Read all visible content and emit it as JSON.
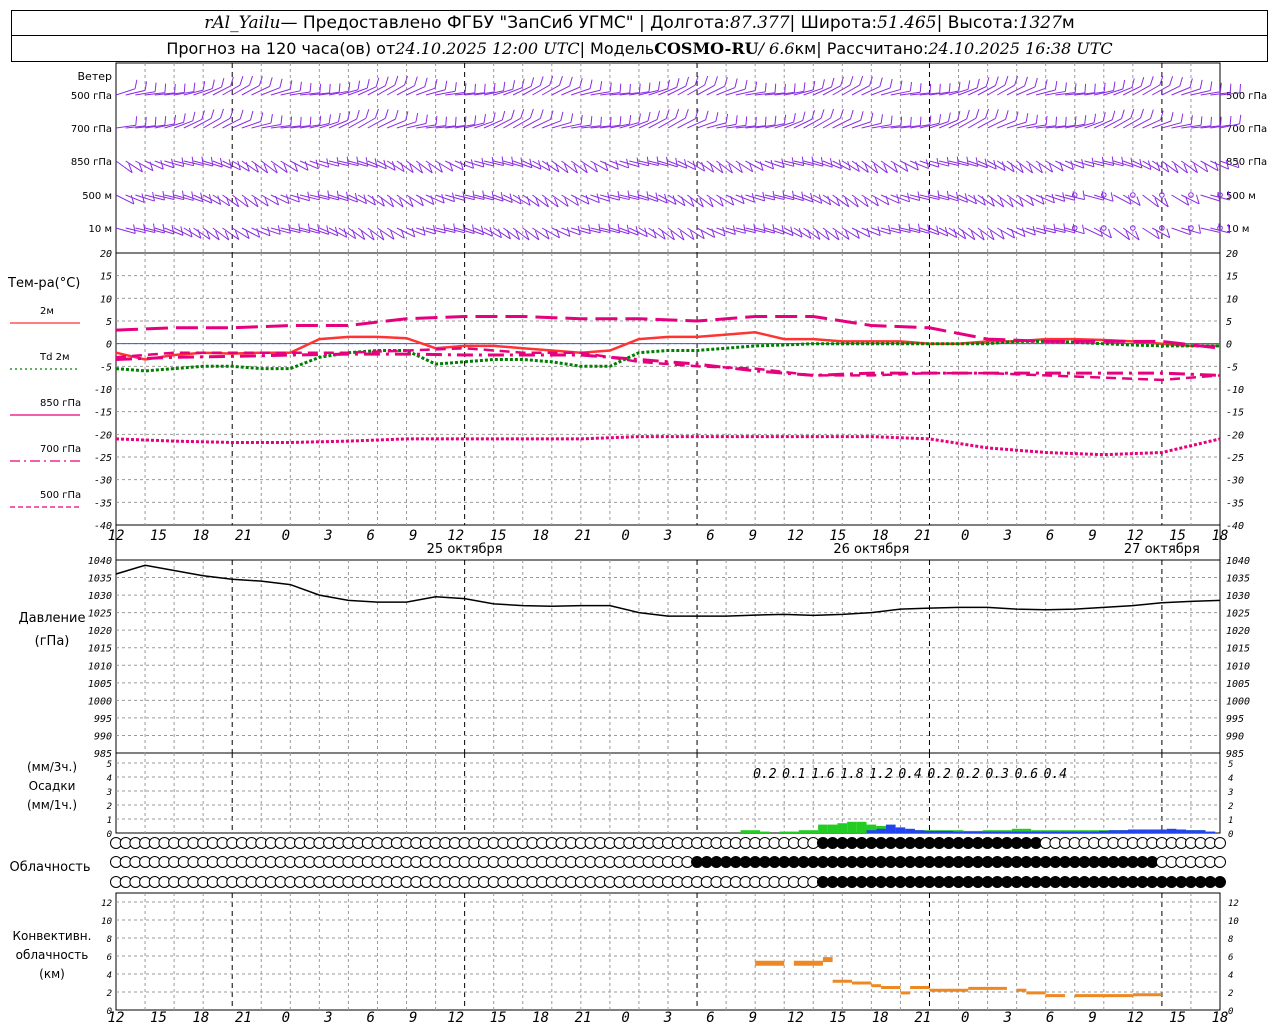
{
  "header": {
    "station": "rAl_Yailu",
    "provider": " — Предоставлено ФГБУ \"ЗапСиб УГМС\" | Долгота: ",
    "lon": "87.377",
    "lat_label": " | Широта: ",
    "lat": "51.465",
    "alt_label": " | Высота: ",
    "alt": "1327",
    "alt_unit": "м",
    "forecast_label": "Прогноз на 120 часа(ов) от ",
    "forecast_start": "24.10.2025 12:00 UTC",
    "model_label": "  | Модель ",
    "model": "COSMO-RU",
    "res": " / 6.6",
    "res_unit": "км",
    "calc_label": " | Рассчитано: ",
    "calc_time": "24.10.2025 16:38 UTC"
  },
  "colors": {
    "wind": "#8a2be2",
    "t2m": "#ff3333",
    "td2m": "#007f00",
    "t850": "#e6007e",
    "t700": "#e6007e",
    "t500": "#e6007e",
    "pressure": "#000000",
    "precip_rain": "#22cc22",
    "precip_snow": "#2244ee",
    "convective": "#ee8822",
    "grid": "#9a9a9a"
  },
  "chart_data": {
    "type": "line",
    "x_ticks": [
      "12",
      "15",
      "18",
      "21",
      "0",
      "3",
      "6",
      "9",
      "12",
      "15",
      "18",
      "21",
      "0",
      "3",
      "6",
      "9",
      "12",
      "15",
      "18",
      "21",
      "0",
      "3",
      "6",
      "9",
      "12",
      "15",
      "18"
    ],
    "day_labels": [
      "25 октября",
      "26 октября",
      "27 октября"
    ],
    "wind": {
      "label": "Ветер",
      "levels": [
        "500 гПа",
        "700 гПа",
        "850 гПа",
        "500 м",
        "10  м"
      ]
    },
    "temperature": {
      "label": "Тем-ра(°С)",
      "ylim": [
        -40,
        20
      ],
      "y_ticks": [
        20,
        15,
        10,
        5,
        0,
        -5,
        -10,
        -15,
        -20,
        -25,
        -30,
        -35,
        -40
      ],
      "legend": [
        {
          "key": "t2m",
          "label": "2м",
          "style": "solid"
        },
        {
          "key": "td2m",
          "label": "Td  2м",
          "style": "dotted"
        },
        {
          "key": "t850",
          "label": "850 гПа",
          "style": "solid"
        },
        {
          "key": "t700",
          "label": "700 гПа",
          "style": "dashdot"
        },
        {
          "key": "t500",
          "label": "500 гПа",
          "style": "dashed"
        }
      ],
      "series": [
        {
          "name": "2м",
          "key": "t2m",
          "x": [
            0,
            3,
            6,
            9,
            12,
            15,
            18,
            21,
            24,
            27,
            30,
            33,
            36,
            39,
            42,
            45,
            48,
            51,
            54,
            57,
            60,
            63,
            66,
            69,
            72,
            75,
            78,
            81,
            84,
            87,
            90,
            93,
            96,
            99,
            102,
            105,
            108,
            111,
            114
          ],
          "y": [
            -2,
            -3.5,
            -2.5,
            -2,
            -2.2,
            -2,
            -2,
            1,
            1.5,
            1.5,
            1.2,
            -1,
            -0.5,
            -0.5,
            -1,
            -1.5,
            -2,
            -1.5,
            1,
            1.5,
            1.5,
            2,
            2.5,
            1,
            1,
            0.5,
            0.5,
            0.5,
            0,
            0,
            0.5,
            0.5,
            1,
            1,
            0.8,
            0.5,
            0,
            -0.5,
            -0.5
          ]
        },
        {
          "name": "Td  2м",
          "key": "td2m",
          "x": [
            0,
            3,
            6,
            9,
            12,
            15,
            18,
            21,
            24,
            27,
            30,
            33,
            36,
            39,
            42,
            45,
            48,
            51,
            54,
            57,
            60,
            63,
            66,
            69,
            72,
            75,
            78,
            81,
            84,
            87,
            90,
            93,
            96,
            99,
            102,
            105,
            108,
            111,
            114
          ],
          "y": [
            -5.5,
            -6,
            -5.5,
            -5,
            -5,
            -5.5,
            -5.5,
            -3,
            -2,
            -1.5,
            -1.5,
            -4.5,
            -4,
            -3.5,
            -3.5,
            -4,
            -5,
            -5,
            -2,
            -1.5,
            -1.5,
            -1,
            -0.5,
            -0.3,
            0,
            0,
            0,
            0,
            0,
            0,
            0,
            0.5,
            0.5,
            0.3,
            0,
            -0.3,
            -0.5,
            -0.5,
            -0.5
          ]
        },
        {
          "name": "850 гПа",
          "key": "t850",
          "x": [
            0,
            6,
            12,
            18,
            24,
            30,
            36,
            42,
            48,
            54,
            60,
            66,
            72,
            78,
            84,
            90,
            96,
            102,
            108,
            114
          ],
          "y": [
            -3.5,
            -3,
            -2.8,
            -2.5,
            -2.3,
            -2.3,
            -2.5,
            -2.5,
            -2.5,
            -3.5,
            -4.5,
            -6,
            -7,
            -6.5,
            -6.5,
            -6.5,
            -6.5,
            -6.5,
            -6.5,
            -7
          ]
        },
        {
          "name": "700 гПа",
          "key": "t700",
          "x": [
            0,
            6,
            12,
            18,
            24,
            30,
            36,
            42,
            48,
            54,
            60,
            66,
            72,
            78,
            84,
            90,
            96,
            102,
            108,
            114
          ],
          "y": [
            -3,
            -2,
            -2,
            -2,
            -2,
            -1.5,
            -1,
            -2,
            -2,
            -4,
            -5,
            -5.5,
            -7,
            -7,
            -6.5,
            -6.5,
            -7,
            -7.5,
            -8,
            -7
          ]
        },
        {
          "name": "500 гПа",
          "key": "t500",
          "x": [
            0,
            6,
            12,
            18,
            24,
            30,
            36,
            42,
            48,
            54,
            60,
            66,
            72,
            78,
            84,
            90,
            96,
            102,
            108,
            114
          ],
          "y": [
            -21,
            -21.5,
            -21.8,
            -21.8,
            -21.5,
            -21,
            -21,
            -21,
            -21,
            -20.5,
            -20.5,
            -20.5,
            -20.5,
            -20.5,
            -21,
            -23,
            -24,
            -24.5,
            -24,
            -21
          ]
        },
        {
          "name": "",
          "key": "t850_upper",
          "x": [
            0,
            6,
            12,
            18,
            24,
            30,
            36,
            42,
            48,
            54,
            60,
            66,
            72,
            78,
            84,
            90,
            96,
            102,
            108,
            114
          ],
          "y": [
            3,
            3.5,
            3.5,
            4,
            4,
            5.5,
            6,
            6,
            5.5,
            5.5,
            5,
            6,
            6,
            4,
            3.5,
            1,
            0.5,
            0.5,
            0.5,
            -1
          ]
        }
      ]
    },
    "pressure": {
      "label1": "Давление",
      "label2": "(гПа)",
      "ylim": [
        985,
        1040
      ],
      "y_ticks": [
        1040,
        1035,
        1030,
        1025,
        1020,
        1015,
        1010,
        1005,
        1000,
        995,
        990,
        985
      ],
      "x": [
        0,
        3,
        6,
        9,
        12,
        15,
        18,
        21,
        24,
        27,
        30,
        33,
        36,
        39,
        42,
        45,
        48,
        51,
        54,
        57,
        60,
        63,
        66,
        69,
        72,
        75,
        78,
        81,
        84,
        87,
        90,
        93,
        96,
        99,
        102,
        105,
        108,
        111,
        114
      ],
      "y": [
        1036,
        1038.5,
        1037,
        1035.5,
        1034.5,
        1034,
        1033,
        1030,
        1028.5,
        1028,
        1028,
        1029.5,
        1029,
        1027.5,
        1027,
        1026.8,
        1027,
        1027,
        1025,
        1024,
        1024,
        1024,
        1024.3,
        1024.5,
        1024.2,
        1024.5,
        1025,
        1026,
        1026.3,
        1026.5,
        1026.5,
        1026,
        1025.8,
        1026,
        1026.5,
        1027,
        1027.8,
        1028.2,
        1028.5
      ]
    },
    "precip": {
      "label_mm3": "(мм/3ч.)",
      "label": "Осадки",
      "label_mm1": "(мм/1ч.)",
      "ylim": [
        0,
        5
      ],
      "y_ticks": [
        5,
        4,
        3,
        2,
        1,
        0
      ],
      "sums": [
        "0.2",
        "0.1",
        "1.6",
        "1.8",
        "1.2",
        "0.4",
        "0.2",
        "0.2",
        "0.3",
        "0.6",
        "0.4"
      ],
      "sum_x": [
        67,
        70,
        73,
        76,
        79,
        82,
        85,
        88,
        91,
        94,
        97
      ],
      "rain": {
        "x": [
          65,
          66,
          67,
          68,
          69,
          70,
          71,
          72,
          73,
          74,
          75,
          76,
          77,
          78,
          79,
          80,
          81,
          82,
          83,
          84,
          85,
          86,
          87,
          88,
          89,
          90,
          91,
          92,
          93,
          94,
          95,
          96,
          97,
          98,
          99,
          100,
          101,
          102,
          103,
          104,
          105,
          106,
          107,
          108,
          109,
          110,
          111,
          112,
          113
        ],
        "y": [
          0.2,
          0.2,
          0.1,
          0,
          0.1,
          0.1,
          0.2,
          0.2,
          0.6,
          0.6,
          0.7,
          0.8,
          0.8,
          0.6,
          0.5,
          0.3,
          0.1,
          0.2,
          0.2,
          0.2,
          0.2,
          0.2,
          0.2,
          0.15,
          0.15,
          0.2,
          0.2,
          0.2,
          0.3,
          0.3,
          0.2,
          0.2,
          0.2,
          0.2,
          0.2,
          0.2,
          0.2,
          0.2,
          0.2,
          0.2,
          0.2,
          0.2,
          0.2,
          0.2,
          0.2,
          0.2,
          0.2,
          0.2,
          0.1
        ]
      },
      "snow": {
        "x": [
          78,
          79,
          80,
          81,
          82,
          83,
          84,
          85,
          86,
          87,
          88,
          89,
          90,
          91,
          92,
          93,
          94,
          95,
          96,
          97,
          98,
          99,
          100,
          101,
          102,
          103,
          104,
          105,
          106,
          107,
          108,
          109,
          110,
          111,
          112,
          113
        ],
        "y": [
          0.2,
          0.3,
          0.6,
          0.4,
          0.3,
          0.2,
          0.15,
          0.15,
          0.15,
          0.1,
          0.1,
          0.1,
          0.1,
          0.1,
          0.1,
          0.1,
          0.1,
          0.1,
          0.1,
          0.1,
          0.1,
          0.1,
          0.1,
          0.1,
          0.15,
          0.2,
          0.2,
          0.25,
          0.25,
          0.25,
          0.25,
          0.3,
          0.25,
          0.2,
          0.2,
          0.1
        ]
      }
    },
    "cloud": {
      "label": "Облачность",
      "rows": [
        [
          0,
          0,
          1,
          0,
          0,
          0,
          0,
          0,
          0,
          0,
          0,
          0,
          0,
          0,
          0,
          0,
          0,
          0,
          0,
          0,
          0,
          0,
          0,
          0,
          0,
          0,
          0,
          0,
          0,
          0,
          0,
          0,
          0,
          0,
          0,
          0,
          0,
          0,
          0,
          0,
          0,
          0,
          0,
          0,
          0,
          0,
          0,
          0,
          0,
          0,
          0,
          0,
          0,
          0,
          0,
          0,
          0,
          0,
          0,
          0,
          0,
          0,
          0,
          0,
          0,
          0,
          0,
          0,
          0,
          0,
          0,
          0,
          0,
          0,
          0,
          0,
          0,
          0,
          0,
          0,
          0,
          0,
          0,
          0,
          0,
          0,
          0,
          0,
          0,
          0,
          0,
          0,
          0,
          0,
          0,
          0,
          0,
          0,
          0,
          0,
          0,
          0,
          0,
          0,
          0,
          0,
          0,
          0,
          0,
          0,
          0,
          0,
          0,
          0,
          0
        ],
        [
          0,
          0,
          0,
          0,
          0,
          0,
          0,
          0,
          0,
          0,
          0,
          0,
          0,
          0,
          0,
          0,
          0,
          0,
          0,
          0,
          0,
          0,
          0,
          0,
          0,
          0,
          0,
          0,
          0,
          0,
          0,
          0,
          0,
          0,
          0,
          0,
          0,
          0,
          0,
          0,
          0,
          0,
          0,
          0,
          0,
          0,
          0,
          0,
          0,
          0,
          0,
          0,
          0,
          0,
          0,
          0,
          0,
          0,
          0,
          0,
          0,
          0,
          0,
          0,
          0,
          0,
          0,
          0,
          0,
          0,
          0,
          0,
          0,
          0,
          0,
          0,
          0,
          0,
          0,
          0,
          0,
          0,
          0,
          0,
          0,
          0,
          0,
          0,
          0,
          0,
          0,
          0,
          0,
          0,
          0,
          0,
          0,
          0,
          0,
          0,
          0,
          0,
          0,
          0,
          0,
          0,
          0,
          0,
          0,
          0,
          0,
          0,
          0,
          0,
          0
        ],
        [
          0,
          0,
          0,
          0,
          0,
          0,
          0,
          0,
          0,
          0,
          0,
          0,
          0,
          0,
          0,
          0,
          0,
          0,
          0,
          0,
          0,
          0,
          0,
          0,
          0,
          0,
          0,
          0,
          0,
          0,
          0,
          0,
          0,
          0,
          0,
          0,
          0,
          0,
          0,
          0,
          0,
          0,
          0,
          0,
          0,
          0,
          0,
          0,
          0,
          0,
          0,
          0,
          0,
          0,
          0,
          0,
          0,
          0,
          0,
          0,
          0,
          0,
          0,
          0,
          0,
          0,
          0,
          0,
          0,
          0,
          0,
          0,
          0,
          0,
          0,
          0,
          0,
          0,
          0,
          0,
          0,
          0,
          0,
          0,
          0,
          0,
          0,
          0,
          0,
          0,
          0,
          0,
          0,
          0,
          0,
          0,
          0,
          0,
          0,
          0,
          0,
          0,
          0,
          0,
          0,
          0,
          0,
          0,
          0,
          0,
          0,
          0,
          0,
          0,
          0
        ]
      ],
      "note": ""
    },
    "convective": {
      "label1": "Конвективн.",
      "label2": "облачность",
      "label3": "(км)",
      "ylim": [
        0,
        13
      ],
      "y_ticks": [
        12,
        10,
        8,
        6,
        4,
        2,
        0
      ],
      "segments": [
        {
          "x0": 66,
          "x1": 69,
          "y": 5.2
        },
        {
          "x0": 70,
          "x1": 73,
          "y": 5.2
        },
        {
          "x0": 73,
          "x1": 74,
          "y": 5.6
        },
        {
          "x0": 74,
          "x1": 76,
          "y": 3.2
        },
        {
          "x0": 76,
          "x1": 78,
          "y": 3
        },
        {
          "x0": 78,
          "x1": 79,
          "y": 2.7
        },
        {
          "x0": 79,
          "x1": 81,
          "y": 2.5
        },
        {
          "x0": 81,
          "x1": 82,
          "y": 1.9
        },
        {
          "x0": 82,
          "x1": 84,
          "y": 2.5
        },
        {
          "x0": 84,
          "x1": 88,
          "y": 2.2
        },
        {
          "x0": 88,
          "x1": 92,
          "y": 2.4
        },
        {
          "x0": 93,
          "x1": 94,
          "y": 2.2
        },
        {
          "x0": 94,
          "x1": 96,
          "y": 1.9
        },
        {
          "x0": 96,
          "x1": 98,
          "y": 1.6
        },
        {
          "x0": 99,
          "x1": 105,
          "y": 1.6
        },
        {
          "x0": 105,
          "x1": 108,
          "y": 1.7
        }
      ]
    }
  }
}
